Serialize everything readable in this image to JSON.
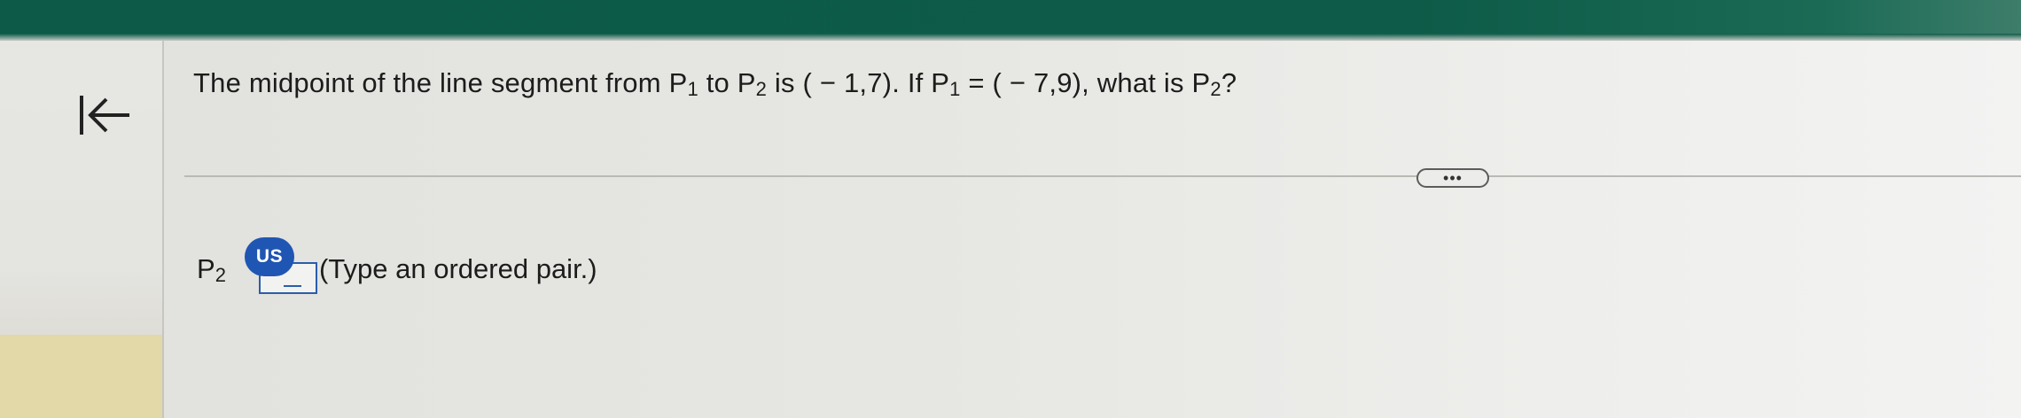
{
  "question": {
    "text_1": "The midpoint of the line segment from P",
    "sub_1": "1",
    "text_2": " to P",
    "sub_2": "2",
    "text_3": " is ( − 1,7). If P",
    "sub_3": "1",
    "text_4": " = ( − 7,9), what is P",
    "sub_4": "2",
    "text_5": "?"
  },
  "more_button": {
    "label": "•••"
  },
  "answer": {
    "label": "P",
    "label_sub": "2",
    "input_value": "",
    "badge": "US",
    "hint": "(Type an ordered pair.)"
  },
  "icons": {
    "collapse": "collapse-left-bar-arrow-icon"
  },
  "colors": {
    "header": "#0c5a47",
    "badge": "#1f56b3",
    "input_border": "#2a5dab",
    "left_panel_accent": "#e3d8a7"
  }
}
